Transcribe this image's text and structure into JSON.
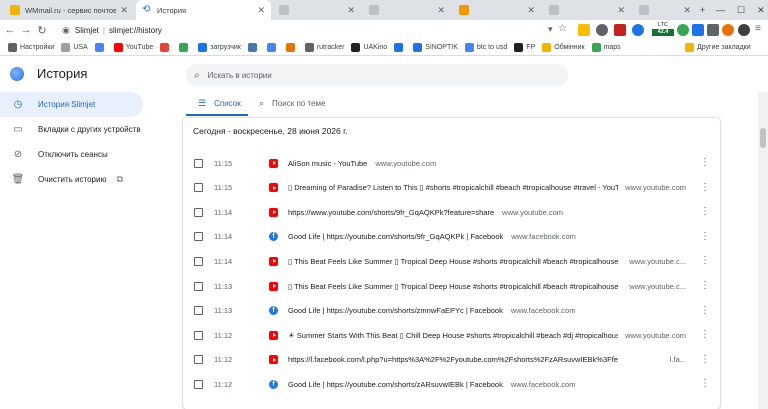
{
  "tabs": [
    {
      "title": "WMmail.ru - сервис почтовых ра",
      "active": false,
      "favicon": "wmmail-icon",
      "color": "#f4b400"
    },
    {
      "title": "История",
      "active": true,
      "favicon": "history-icon",
      "color": "#1a73e8"
    }
  ],
  "toolbar": {
    "site_name": "Slimjet",
    "url": "slimjet://history",
    "ltc_label": "LTC",
    "ltc_value": "42.4"
  },
  "bookmarks": [
    {
      "label": "Настройки",
      "icon": "gear-icon",
      "color": "#5f6368"
    },
    {
      "label": "USA",
      "icon": "globe-icon",
      "color": "#9aa0a6"
    },
    {
      "label": "",
      "icon": "google-icon",
      "color": "#4285f4"
    },
    {
      "label": "YouTube",
      "icon": "youtube-icon",
      "color": "#ff0000"
    },
    {
      "label": "",
      "icon": "gmail-icon",
      "color": "#ea4335"
    },
    {
      "label": "",
      "icon": "drive-icon",
      "color": "#34a853"
    },
    {
      "label": "загрузчик",
      "icon": "download-icon",
      "color": "#1a73e8"
    },
    {
      "label": "",
      "icon": "vk-icon",
      "color": "#4a76a8"
    },
    {
      "label": "",
      "icon": "google-icon",
      "color": "#4285f4"
    },
    {
      "label": "",
      "icon": "flag-icon",
      "color": "#e8710a"
    },
    {
      "label": "rutracker",
      "icon": "rutracker-icon",
      "color": "#5f6368"
    },
    {
      "label": "UAKino",
      "icon": "uakino-icon",
      "color": "#202124"
    },
    {
      "label": "",
      "icon": "thermometer-icon",
      "color": "#1a73e8"
    },
    {
      "label": "SINOPTIK",
      "icon": "sinoptik-icon",
      "color": "#1a73e8"
    },
    {
      "label": "btc to usd",
      "icon": "google-icon",
      "color": "#4285f4"
    },
    {
      "label": "FP",
      "icon": "fp-icon",
      "color": "#202124"
    },
    {
      "label": "Обмінник",
      "icon": "exchange-icon",
      "color": "#f4b400"
    },
    {
      "label": "maps",
      "icon": "maps-icon",
      "color": "#34a853"
    },
    {
      "label": "Другие закладки",
      "icon": "folder-icon",
      "color": "#f4b400"
    }
  ],
  "header": {
    "title": "История",
    "search_placeholder": "Искать в истории"
  },
  "sidebar": {
    "items": [
      {
        "label": "История Slimjet",
        "icon": "history-icon",
        "active": true
      },
      {
        "label": "Вкладки с других устройств",
        "icon": "devices-icon",
        "active": false
      },
      {
        "label": "Отключить сеансы",
        "icon": "sync-off-icon",
        "active": false
      },
      {
        "label": "Очистить историю",
        "icon": "trash-icon",
        "active": false
      }
    ]
  },
  "main": {
    "tabs": [
      {
        "label": "Список",
        "icon": "list-icon",
        "active": true
      },
      {
        "label": "Поиск по теме",
        "icon": "topic-search-icon",
        "active": false
      }
    ],
    "date_header": "Сегодня - воскресенье, 28 июня 2026 г.",
    "rows": [
      {
        "time": "11:15",
        "site": "youtube",
        "title": "AliSon music - YouTube",
        "domain": "www.youtube.com",
        "domain_right": ""
      },
      {
        "time": "11:15",
        "site": "youtube",
        "title": "▯ Dreaming of Paradise? Listen to This ▯ #shorts #tropicalchill #beach #tropicalhouse #travel - YouT...",
        "domain": "",
        "domain_right": "www.youtube.com"
      },
      {
        "time": "11:14",
        "site": "youtube",
        "title": "https://www.youtube.com/shorts/9fr_GqAQKPk?feature=share",
        "domain": "www.youtube.com",
        "domain_right": ""
      },
      {
        "time": "11:14",
        "site": "facebook",
        "title": "Good Life | https://youtube.com/shorts/9fr_GqAQKPk | Facebook",
        "domain": "www.facebook.com",
        "domain_right": ""
      },
      {
        "time": "11:14",
        "site": "youtube",
        "title": "▯ This Beat Feels Like Summer ▯ Tropical Deep House #shorts #tropicalchill #beach #tropicalhouse - ...",
        "domain": "",
        "domain_right": "www.youtube.c..."
      },
      {
        "time": "11:13",
        "site": "youtube",
        "title": "▯ This Beat Feels Like Summer ▯ Tropical Deep House #shorts #tropicalchill #beach #tropicalhouse - ...",
        "domain": "",
        "domain_right": "www.youtube.c..."
      },
      {
        "time": "11:13",
        "site": "facebook",
        "title": "Good Life | https://youtube.com/shorts/zmnwFaEPYc | Facebook",
        "domain": "www.facebook.com",
        "domain_right": ""
      },
      {
        "time": "11:12",
        "site": "youtube",
        "title": "☀ Summer Starts With This Beat ▯ Chill Deep House #shorts #tropicalchill #beach #dj #tropicalhouse ...",
        "domain": "",
        "domain_right": "www.youtube.com"
      },
      {
        "time": "11:12",
        "site": "youtube",
        "title": "https://l.facebook.com/l.php?u=https%3A%2F%2Fyoutube.com%2Fshorts%2FzARsuvwIEBk%3Ffeature%3Dshare...",
        "domain": "",
        "domain_right": "l.fa..."
      },
      {
        "time": "11:12",
        "site": "facebook",
        "title": "Good Life | https://youtube.com/shorts/zARsuvwIEBk | Facebook",
        "domain": "www.facebook.com",
        "domain_right": ""
      }
    ]
  }
}
